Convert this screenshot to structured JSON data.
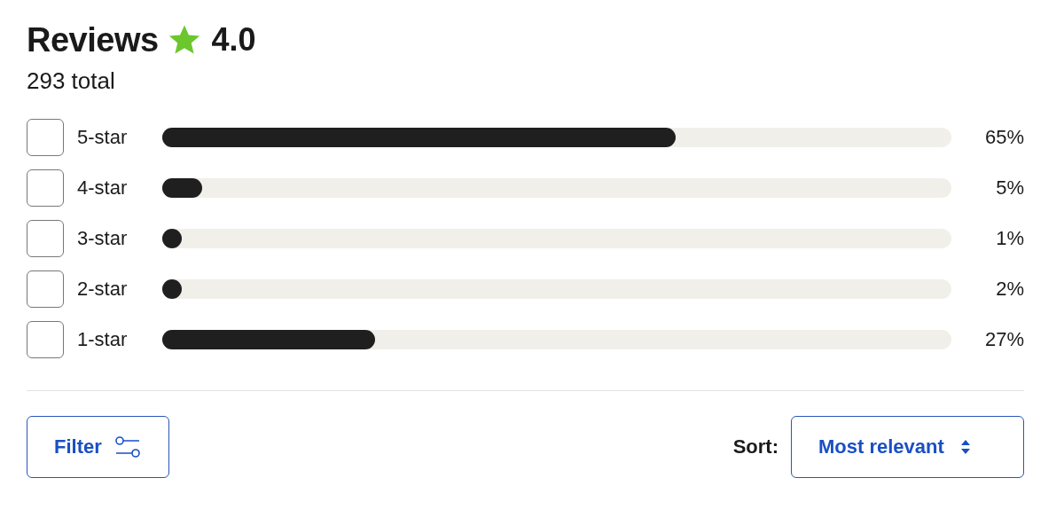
{
  "header": {
    "title": "Reviews",
    "rating": "4.0",
    "total": "293 total"
  },
  "ratings": [
    {
      "label": "5-star",
      "checked": false,
      "level": 0.65,
      "percent": "65%"
    },
    {
      "label": "4-star",
      "checked": false,
      "level": 0.05,
      "percent": "5%"
    },
    {
      "label": "3-star",
      "checked": false,
      "level": 0.01,
      "percent": "1%"
    },
    {
      "label": "2-star",
      "checked": false,
      "level": 0.02,
      "percent": "2%"
    },
    {
      "label": "1-star",
      "checked": false,
      "level": 0.27,
      "percent": "27%"
    }
  ],
  "filter_button": {
    "label": "Filter"
  },
  "sort": {
    "label": "Sort:",
    "value": "Most relevant"
  }
}
